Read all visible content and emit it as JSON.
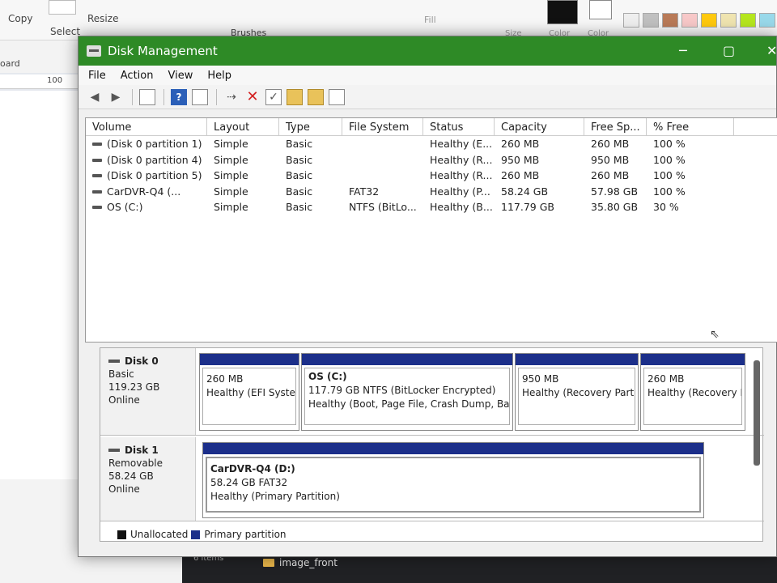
{
  "paint": {
    "copy": "Copy",
    "resize": "Resize",
    "select": "Select",
    "brushes": "Brushes",
    "fill": "Fill",
    "size": "Size",
    "color1": "Color",
    "color2": "Color",
    "clipboard": "oard",
    "ruler": "100"
  },
  "desktop": {
    "folder": "image_front",
    "items": "6 items"
  },
  "window": {
    "title": "Disk Management",
    "menu": [
      "File",
      "Action",
      "View",
      "Help"
    ]
  },
  "columns": [
    "Volume",
    "Layout",
    "Type",
    "File System",
    "Status",
    "Capacity",
    "Free Sp...",
    "% Free"
  ],
  "volumes": [
    {
      "volume": "(Disk 0 partition 1)",
      "layout": "Simple",
      "type": "Basic",
      "fs": "",
      "status": "Healthy (E...",
      "capacity": "260 MB",
      "free": "260 MB",
      "pct": "100 %"
    },
    {
      "volume": "(Disk 0 partition 4)",
      "layout": "Simple",
      "type": "Basic",
      "fs": "",
      "status": "Healthy (R...",
      "capacity": "950 MB",
      "free": "950 MB",
      "pct": "100 %"
    },
    {
      "volume": "(Disk 0 partition 5)",
      "layout": "Simple",
      "type": "Basic",
      "fs": "",
      "status": "Healthy (R...",
      "capacity": "260 MB",
      "free": "260 MB",
      "pct": "100 %"
    },
    {
      "volume": "CarDVR-Q4 (...",
      "layout": "Simple",
      "type": "Basic",
      "fs": "FAT32",
      "status": "Healthy (P...",
      "capacity": "58.24 GB",
      "free": "57.98 GB",
      "pct": "100 %"
    },
    {
      "volume": "OS (C:)",
      "layout": "Simple",
      "type": "Basic",
      "fs": "NTFS (BitLo...",
      "status": "Healthy (B...",
      "capacity": "117.79 GB",
      "free": "35.80 GB",
      "pct": "30 %"
    }
  ],
  "disk0": {
    "name": "Disk 0",
    "type": "Basic",
    "size": "119.23 GB",
    "state": "Online",
    "parts": [
      {
        "title": "",
        "line1": "260 MB",
        "line2": "Healthy (EFI Systen"
      },
      {
        "title": "OS  (C:)",
        "line1": "117.79 GB NTFS (BitLocker Encrypted)",
        "line2": "Healthy (Boot, Page File, Crash Dump, Basi"
      },
      {
        "title": "",
        "line1": "950 MB",
        "line2": "Healthy (Recovery Partit"
      },
      {
        "title": "",
        "line1": "260 MB",
        "line2": "Healthy (Recovery I"
      }
    ]
  },
  "disk1": {
    "name": "Disk 1",
    "type": "Removable",
    "size": "58.24 GB",
    "state": "Online",
    "part": {
      "title": "CarDVR-Q4  (D:)",
      "line1": "58.24 GB FAT32",
      "line2": "Healthy (Primary Partition)"
    }
  },
  "legend": {
    "unallocated": "Unallocated",
    "primary": "Primary partition"
  },
  "colors": {
    "titlebar": "#2e8a26",
    "primary": "#1c2f8a",
    "unallocated": "#111111"
  }
}
